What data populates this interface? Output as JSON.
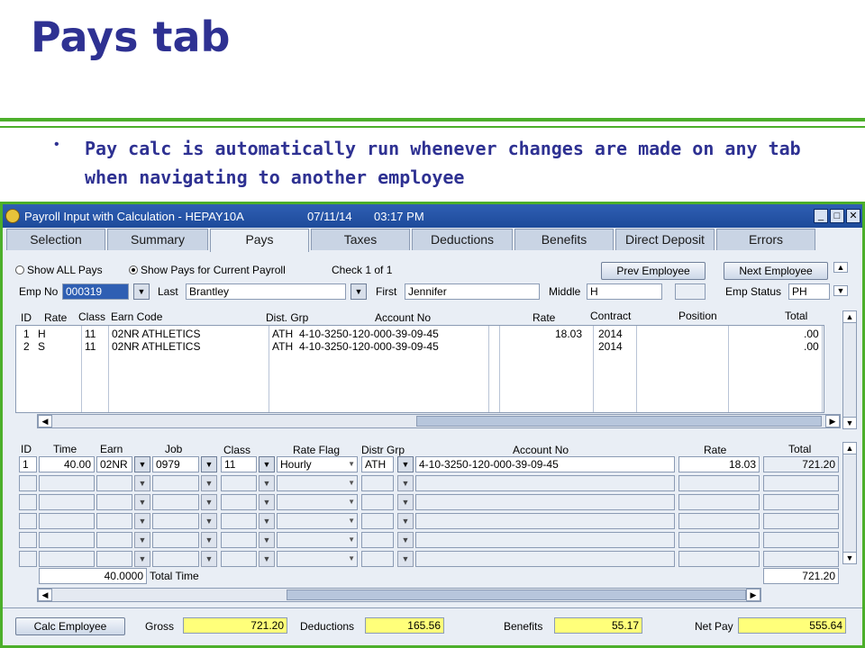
{
  "slide": {
    "title": "Pays tab",
    "bullet": "Pay calc is automatically run whenever changes are made on any tab when navigating to another employee"
  },
  "window": {
    "title": "Payroll Input with Calculation - HEPAY10A",
    "date": "07/11/14",
    "time": "03:17 PM"
  },
  "tabs": [
    "Selection",
    "Summary",
    "Pays",
    "Taxes",
    "Deductions",
    "Benefits",
    "Direct Deposit",
    "Errors"
  ],
  "active_tab": "Pays",
  "filter": {
    "show_all": "Show ALL Pays",
    "show_current": "Show Pays for Current Payroll",
    "check_info": "Check 1 of 1",
    "prev_button": "Prev Employee",
    "next_button": "Next Employee"
  },
  "employee": {
    "emp_no_label": "Emp No",
    "emp_no": "000319",
    "last_label": "Last",
    "last": "Brantley",
    "first_label": "First",
    "first": "Jennifer",
    "middle_label": "Middle",
    "middle": "H",
    "status_label": "Emp Status",
    "status": "PH"
  },
  "upper_grid": {
    "headers": [
      "ID",
      "Rate",
      "Class",
      "Earn Code",
      "Dist. Grp",
      "Account No",
      "Rate",
      "Contract",
      "Position",
      "Total"
    ],
    "rows": [
      {
        "id": "1",
        "rate": "H",
        "class": "11",
        "earn": "02NR  ATHLETICS",
        "dist": "ATH",
        "account": "4-10-3250-120-000-39-09-45",
        "rate_val": "18.03",
        "contract": "2014",
        "position": "",
        "total": ".00"
      },
      {
        "id": "2",
        "rate": "S",
        "class": "11",
        "earn": "02NR  ATHLETICS",
        "dist": "ATH",
        "account": "4-10-3250-120-000-39-09-45",
        "rate_val": "",
        "contract": "2014",
        "position": "",
        "total": ".00"
      }
    ]
  },
  "lower_grid": {
    "headers": [
      "ID",
      "Time",
      "Earn",
      "Job",
      "Class",
      "Rate Flag",
      "Distr Grp",
      "Account No",
      "Rate",
      "Total"
    ],
    "row": {
      "id": "1",
      "time": "40.00",
      "earn": "02NR",
      "job": "0979",
      "class": "11",
      "rate_flag": "Hourly",
      "distr": "ATH",
      "account": "4-10-3250-120-000-39-09-45",
      "rate": "18.03",
      "total": "721.20"
    },
    "total_time_value": "40.0000",
    "total_time_label": "Total Time",
    "grand_total": "721.20"
  },
  "summary": {
    "calc_button": "Calc Employee",
    "gross_label": "Gross",
    "gross": "721.20",
    "deductions_label": "Deductions",
    "deductions": "165.56",
    "benefits_label": "Benefits",
    "benefits": "55.17",
    "net_label": "Net Pay",
    "net": "555.64"
  },
  "colors": {
    "title": "#2e3192",
    "rule": "#4caf2a",
    "titlebar": "#2f5fb3",
    "highlight": "#ffff7a"
  }
}
